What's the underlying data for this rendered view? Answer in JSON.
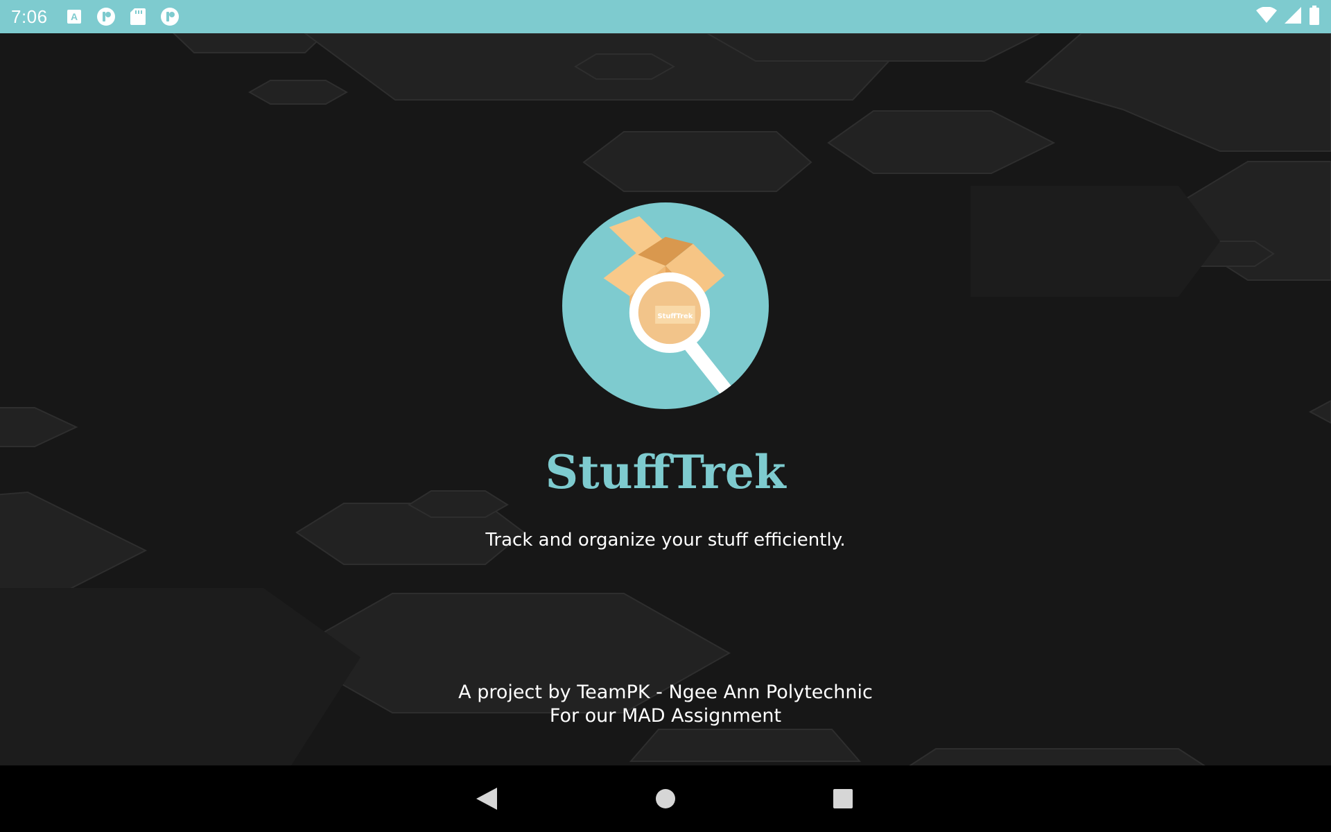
{
  "status_bar": {
    "time": "7:06",
    "background": "#7ecbcf",
    "notification_icons": [
      "font-icon",
      "app-notification-icon",
      "sd-card-icon",
      "app-notification-icon"
    ],
    "system_icons": [
      "wifi-icon",
      "cell-signal-icon",
      "battery-icon"
    ]
  },
  "splash": {
    "logo_text": "StuffTrek",
    "title": "StuffTrek",
    "tagline": "Track and organize your stuff efficiently.",
    "credits_line1": "A project by TeamPK - Ngee Ann Polytechnic",
    "credits_line2": "For our MAD Assignment",
    "accent_color": "#7ecbcf"
  },
  "nav_bar": {
    "buttons": [
      "back-icon",
      "home-icon",
      "recents-icon"
    ]
  }
}
